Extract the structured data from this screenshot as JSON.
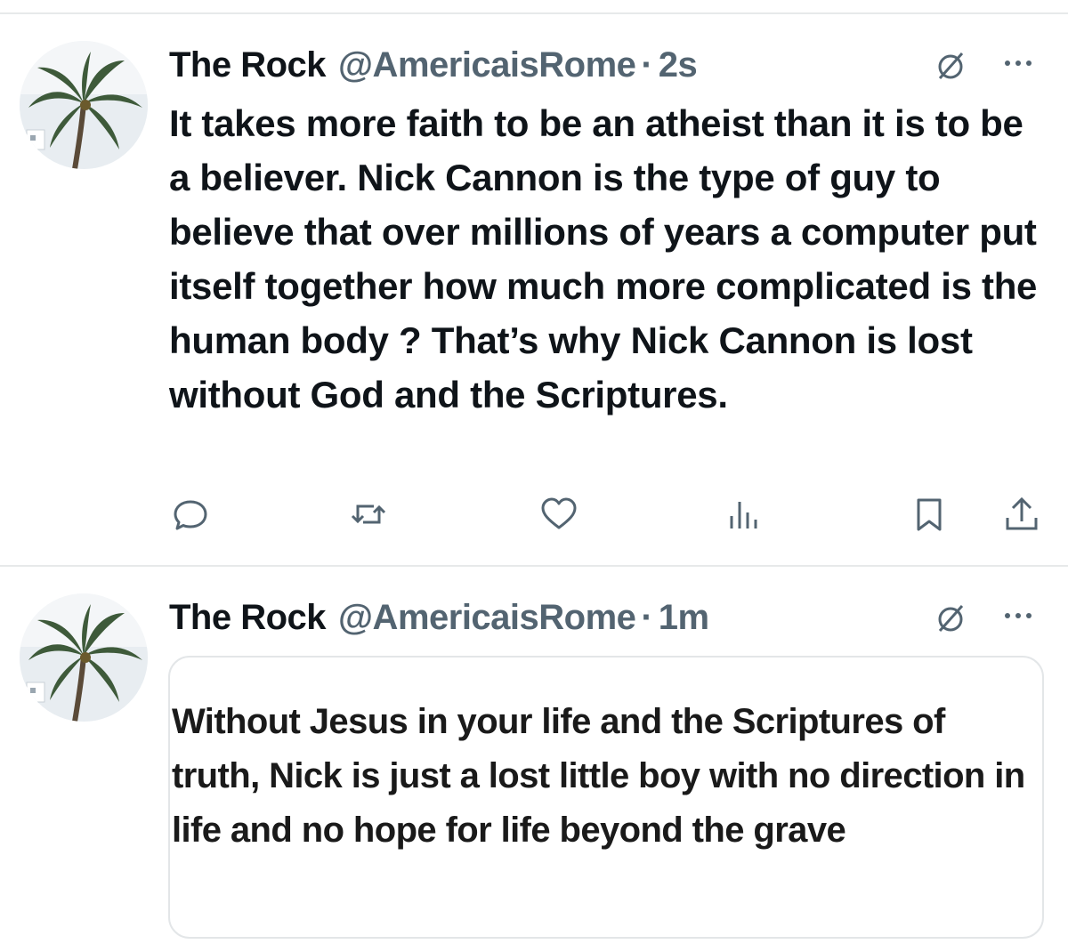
{
  "posts": [
    {
      "author_name": "The Rock",
      "handle": "@AmericaisRome",
      "separator": "·",
      "time": "2s",
      "text": "It takes more faith to be an atheist than it is to be a believer. Nick Cannon is the type of guy to believe that over millions of years a computer put itself together how much more complicated is the human body ? That’s why Nick Cannon is lost without God and the Scriptures.",
      "icons": [
        "grok-icon",
        "more-icon",
        "reply-icon",
        "repost-icon",
        "like-icon",
        "views-icon",
        "bookmark-icon",
        "share-icon"
      ]
    },
    {
      "author_name": "The Rock",
      "handle": "@AmericaisRome",
      "separator": "·",
      "time": "1m",
      "quote_text": "Without Jesus in your life and the Scriptures of truth, Nick is just a lost little boy with no direction in life and no hope for life beyond the grave",
      "icons": [
        "grok-icon",
        "more-icon"
      ]
    }
  ],
  "colors": {
    "text": "#0f1419",
    "secondary": "#536471",
    "divider": "#e7e9ea"
  }
}
